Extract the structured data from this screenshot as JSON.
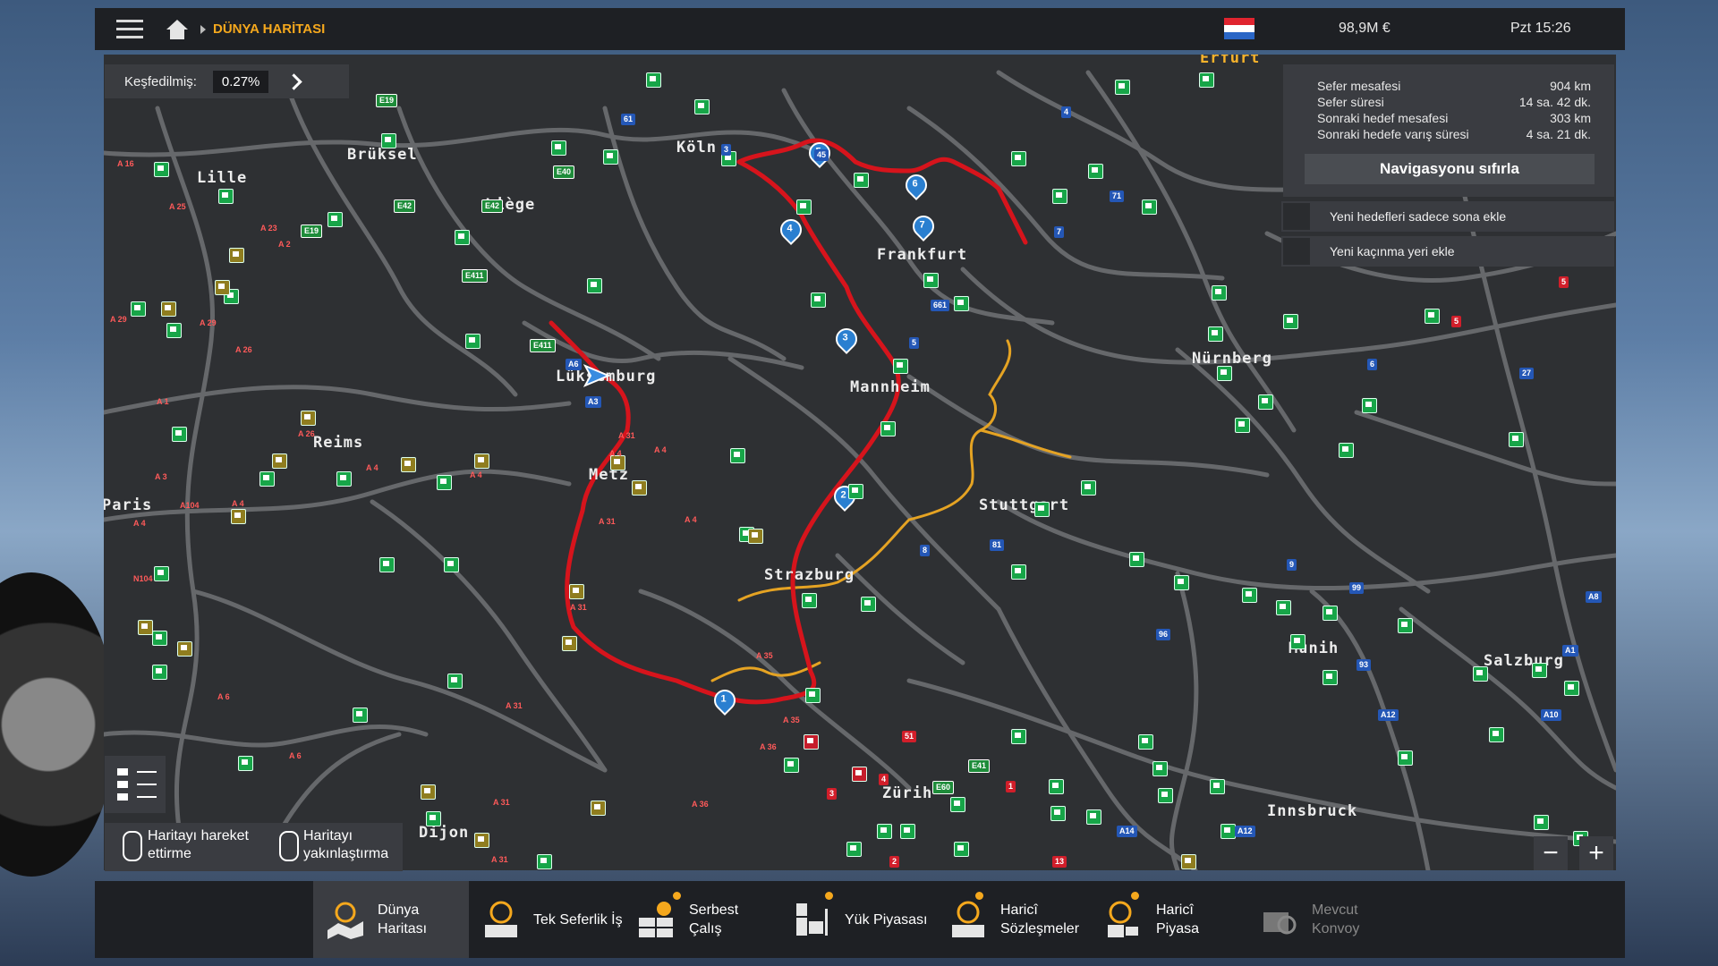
{
  "topbar": {
    "breadcrumb": "DÜNYA HARİTASI",
    "money": "98,9M €",
    "clock": "Pzt 15:26",
    "flag_colors": [
      "#e0242f",
      "#ffffff",
      "#2a66c6"
    ]
  },
  "explored": {
    "label": "Keşfedilmiş:",
    "value": "0.27%"
  },
  "nav": {
    "rows": [
      {
        "label": "Sefer mesafesi",
        "value": "904 km"
      },
      {
        "label": "Sefer süresi",
        "value": "14 sa. 42 dk."
      },
      {
        "label": "Sonraki hedef mesafesi",
        "value": "303 km"
      },
      {
        "label": "Sonraki hedefe varış süresi",
        "value": "4 sa. 21 dk."
      }
    ],
    "reset": "Navigasyonu sıfırla",
    "options": [
      "Yeni hedefleri sadece sona ekle",
      "Yeni kaçınma yeri ekle"
    ]
  },
  "cities": [
    {
      "name": "Erfurt",
      "tone": "yellow"
    },
    {
      "name": "Brüksel",
      "tone": "yellow"
    },
    {
      "name": "Lille",
      "tone": "yellow"
    },
    {
      "name": "Liège",
      "tone": "yellow"
    },
    {
      "name": "Köln",
      "tone": "yellow"
    },
    {
      "name": "Frankfurt",
      "tone": "yellow"
    },
    {
      "name": "Nürnberg",
      "tone": "yellow"
    },
    {
      "name": "Lüksemburg",
      "tone": "yellow"
    },
    {
      "name": "Mannheim",
      "tone": "yellow"
    },
    {
      "name": "Reims",
      "tone": "yellow"
    },
    {
      "name": "Metz",
      "tone": "yellow"
    },
    {
      "name": "Paris",
      "tone": "yellow"
    },
    {
      "name": "Stuttgart",
      "tone": "yellow"
    },
    {
      "name": "Strazburg",
      "tone": "yellow"
    },
    {
      "name": "Münih",
      "tone": "yellow"
    },
    {
      "name": "Salzburg",
      "tone": "yellow"
    },
    {
      "name": "Zürih",
      "tone": "yellow"
    },
    {
      "name": "Innsbruck",
      "tone": "yellow"
    },
    {
      "name": "Dijon",
      "tone": "yellow"
    }
  ],
  "waypoints": [
    "1",
    "2",
    "3",
    "4",
    "5",
    "6",
    "7"
  ],
  "roads": [
    {
      "label": "E19",
      "type": "green"
    },
    {
      "label": "E40",
      "type": "green"
    },
    {
      "label": "E42",
      "type": "green"
    },
    {
      "label": "E42",
      "type": "green"
    },
    {
      "label": "E19",
      "type": "green"
    },
    {
      "label": "E411",
      "type": "green"
    },
    {
      "label": "E411",
      "type": "green"
    },
    {
      "label": "E41",
      "type": "green"
    },
    {
      "label": "E60",
      "type": "green"
    },
    {
      "label": "A6",
      "type": "blue"
    },
    {
      "label": "A3",
      "type": "blue"
    },
    {
      "label": "A8",
      "type": "blue"
    },
    {
      "label": "A1",
      "type": "blue"
    },
    {
      "label": "A12",
      "type": "blue"
    },
    {
      "label": "A10",
      "type": "blue"
    },
    {
      "label": "A14",
      "type": "blue"
    },
    {
      "label": "A12",
      "type": "blue"
    },
    {
      "label": "61",
      "type": "blue"
    },
    {
      "label": "3",
      "type": "blue"
    },
    {
      "label": "45",
      "type": "blue"
    },
    {
      "label": "5",
      "type": "blue"
    },
    {
      "label": "661",
      "type": "blue"
    },
    {
      "label": "7",
      "type": "blue"
    },
    {
      "label": "71",
      "type": "blue"
    },
    {
      "label": "27",
      "type": "blue"
    },
    {
      "label": "6",
      "type": "blue"
    },
    {
      "label": "81",
      "type": "blue"
    },
    {
      "label": "8",
      "type": "blue"
    },
    {
      "label": "96",
      "type": "blue"
    },
    {
      "label": "93",
      "type": "blue"
    },
    {
      "label": "99",
      "type": "blue"
    },
    {
      "label": "9",
      "type": "blue"
    },
    {
      "label": "4",
      "type": "blue"
    },
    {
      "label": "5",
      "type": "red"
    },
    {
      "label": "5",
      "type": "red"
    },
    {
      "label": "51",
      "type": "red"
    },
    {
      "label": "3",
      "type": "red"
    },
    {
      "label": "4",
      "type": "red"
    },
    {
      "label": "1",
      "type": "red"
    },
    {
      "label": "13",
      "type": "red"
    },
    {
      "label": "2",
      "type": "red"
    },
    {
      "label": "A 16",
      "type": "roadlabel"
    },
    {
      "label": "A 25",
      "type": "roadlabel"
    },
    {
      "label": "A 23",
      "type": "roadlabel"
    },
    {
      "label": "A 2",
      "type": "roadlabel"
    },
    {
      "label": "A 29",
      "type": "roadlabel"
    },
    {
      "label": "A 29",
      "type": "roadlabel"
    },
    {
      "label": "A 26",
      "type": "roadlabel"
    },
    {
      "label": "A 1",
      "type": "roadlabel"
    },
    {
      "label": "A 3",
      "type": "roadlabel"
    },
    {
      "label": "A 4",
      "type": "roadlabel"
    },
    {
      "label": "A 4",
      "type": "roadlabel"
    },
    {
      "label": "A104",
      "type": "roadlabel"
    },
    {
      "label": "A 4",
      "type": "roadlabel"
    },
    {
      "label": "A 4",
      "type": "roadlabel"
    },
    {
      "label": "A 31",
      "type": "roadlabel"
    },
    {
      "label": "A 31",
      "type": "roadlabel"
    },
    {
      "label": "A 31",
      "type": "roadlabel"
    },
    {
      "label": "A 4",
      "type": "roadlabel"
    },
    {
      "label": "A 4",
      "type": "roadlabel"
    },
    {
      "label": "A 4",
      "type": "roadlabel"
    },
    {
      "label": "N104",
      "type": "roadlabel"
    },
    {
      "label": "A 6",
      "type": "roadlabel"
    },
    {
      "label": "A 6",
      "type": "roadlabel"
    },
    {
      "label": "A 31",
      "type": "roadlabel"
    },
    {
      "label": "A 35",
      "type": "roadlabel"
    },
    {
      "label": "A 35",
      "type": "roadlabel"
    },
    {
      "label": "A 36",
      "type": "roadlabel"
    },
    {
      "label": "A 36",
      "type": "roadlabel"
    },
    {
      "label": "A 31",
      "type": "roadlabel"
    },
    {
      "label": "A 31",
      "type": "roadlabel"
    },
    {
      "label": "A 26",
      "type": "roadlabel"
    }
  ],
  "hints": {
    "move": "Haritayı hareket ettirme",
    "zoom": "Haritayı yakınlaştırma"
  },
  "zoom": {
    "minus": "−",
    "plus": "+"
  },
  "tabs": [
    {
      "label": "Dünya Haritası",
      "active": true,
      "dot": false,
      "dim": false
    },
    {
      "label": "Tek Seferlik İş",
      "active": false,
      "dot": false,
      "dim": false
    },
    {
      "label": "Serbest Çalış",
      "active": false,
      "dot": true,
      "dim": false
    },
    {
      "label": "Yük Piyasası",
      "active": false,
      "dot": true,
      "dim": false
    },
    {
      "label": "Haricî Sözleşmeler",
      "active": false,
      "dot": true,
      "dim": false
    },
    {
      "label": "Haricî Piyasa",
      "active": false,
      "dot": true,
      "dim": false
    },
    {
      "label": "Mevcut Konvoy",
      "active": false,
      "dot": false,
      "dim": true
    }
  ],
  "colors": {
    "accent": "#f5a81d",
    "route": "#d6141c",
    "road": "#6b6d70",
    "poi_green": "#17a548",
    "bar": "#1e2024"
  }
}
